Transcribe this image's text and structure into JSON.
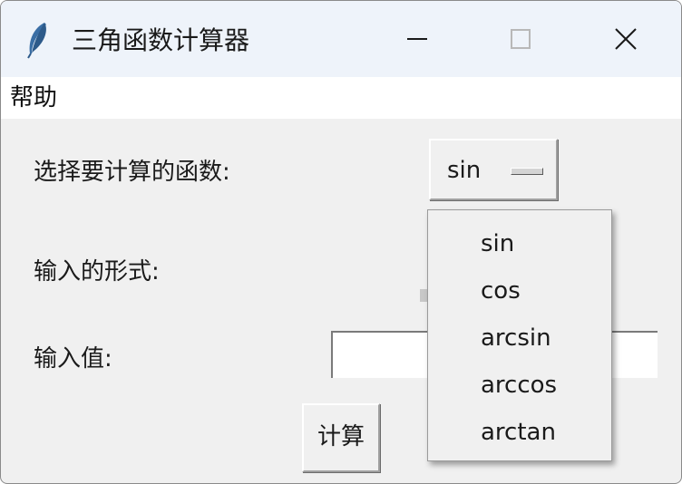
{
  "window": {
    "title": "三角函数计算器",
    "icon": "feather-icon",
    "controls": [
      "minimize-icon",
      "maximize-icon",
      "close-icon"
    ]
  },
  "menubar": {
    "items": [
      {
        "label": "帮助"
      }
    ]
  },
  "form": {
    "function_label": "选择要计算的函数:",
    "selected_function": "sin",
    "input_format_label": "输入的形式:",
    "value_label": "输入值:",
    "value": "",
    "calculate_button": "计算"
  },
  "dropdown": {
    "options": [
      "sin",
      "cos",
      "arcsin",
      "arccos",
      "arctan"
    ]
  }
}
